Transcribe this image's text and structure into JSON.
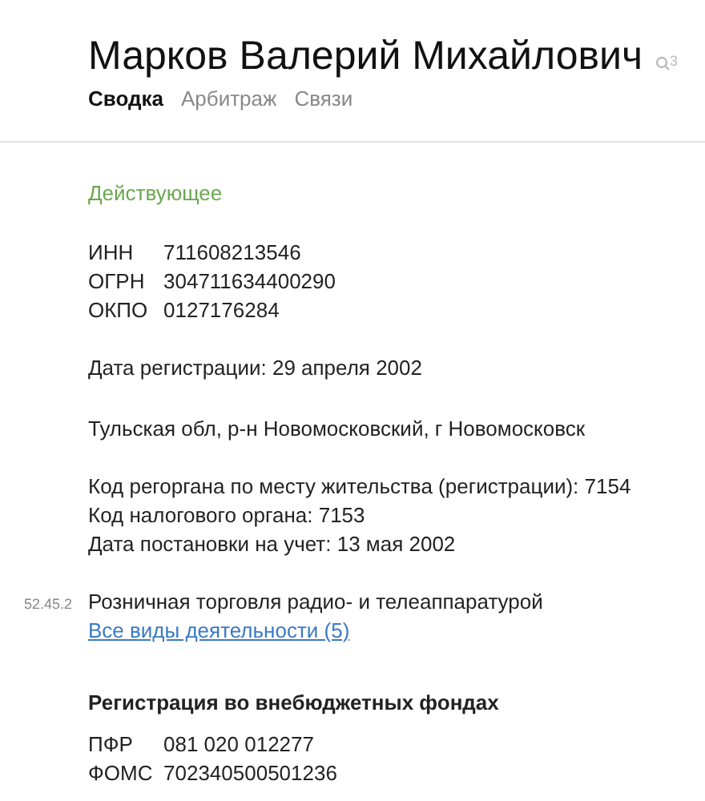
{
  "header": {
    "title": "Марков Валерий Михайлович",
    "search_count": "3"
  },
  "tabs": [
    {
      "label": "Сводка",
      "selected": true
    },
    {
      "label": "Арбитраж",
      "selected": false
    },
    {
      "label": "Связи",
      "selected": false
    }
  ],
  "status": "Действующее",
  "codes": [
    {
      "label": "ИНН",
      "value": "711608213546"
    },
    {
      "label": "ОГРН",
      "value": "304711634400290"
    },
    {
      "label": "ОКПО",
      "value": "0127176284"
    }
  ],
  "registration_date": "Дата регистрации: 29 апреля 2002",
  "address": "Тульская обл, р-н Новомосковский, г Новомосковск",
  "tax_info": [
    "Код регоргана по месту жительства (регистрации): 7154",
    "Код налогового органа: 7153",
    "Дата постановки на учет: 13 мая 2002"
  ],
  "activity": {
    "code": "52.45.2",
    "name": "Розничная торговля радио- и телеаппаратурой",
    "link": "Все виды деятельности (5)"
  },
  "funds": {
    "heading": "Регистрация во внебюджетных фондах",
    "codes": [
      {
        "label": "ПФР",
        "value": "081 020 012277"
      },
      {
        "label": "ФОМС",
        "value": "702340500501236"
      }
    ]
  }
}
